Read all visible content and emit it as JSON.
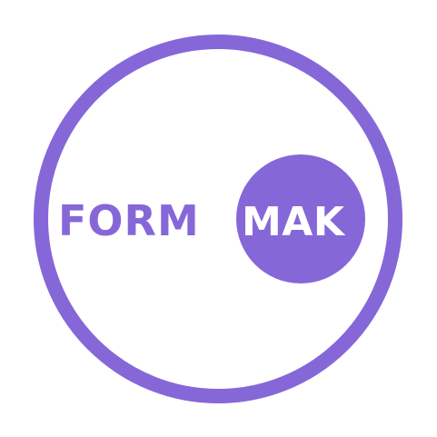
{
  "logo": {
    "word_left": "FORM",
    "word_right": "MAK",
    "colors": {
      "brand": "#8667D8",
      "background": "#FFFFFF",
      "text_on_badge": "#FFFFFF"
    }
  }
}
